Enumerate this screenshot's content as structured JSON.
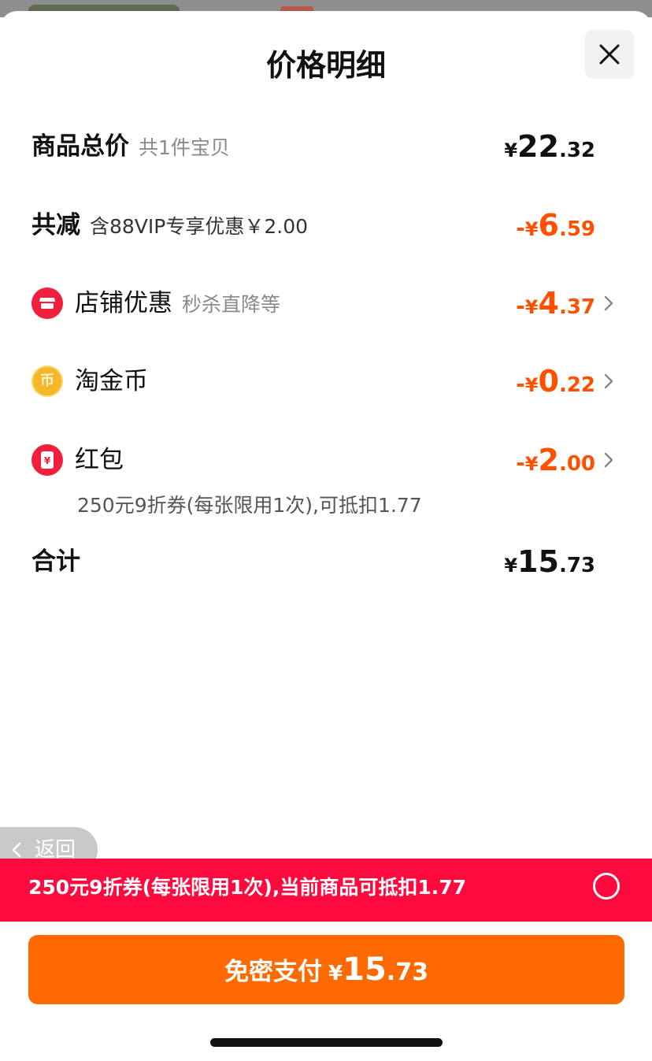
{
  "sheet": {
    "title": "价格明细"
  },
  "rows": {
    "total": {
      "label": "商品总价",
      "sub": "共1件宝贝",
      "sym": "¥",
      "int": "22",
      "dec": ".32"
    },
    "reduced": {
      "label": "共减",
      "sub": "含88VIP专享优惠￥2.00",
      "minus": "-",
      "sym": "¥",
      "int": "6",
      "dec": ".59"
    },
    "shop": {
      "icon": "shop-icon",
      "label": "店铺优惠",
      "sub": "秒杀直降等",
      "minus": "-",
      "sym": "¥",
      "int": "4",
      "dec": ".37"
    },
    "coins": {
      "icon": "coin-icon",
      "icon_glyph": "币",
      "label": "淘金币",
      "minus": "-",
      "sym": "¥",
      "int": "0",
      "dec": ".22"
    },
    "redpacket": {
      "icon": "red-packet-icon",
      "icon_glyph": "¥",
      "label": "红包",
      "minus": "-",
      "sym": "¥",
      "int": "2",
      "dec": ".00",
      "note": "250元9折券(每张限用1次),可抵扣1.77"
    },
    "sum": {
      "label": "合计",
      "sym": "¥",
      "int": "15",
      "dec": ".73"
    }
  },
  "back": {
    "label": "返回"
  },
  "coupon_bar": {
    "text": "250元9折券(每张限用1次),当前商品可抵扣1.77"
  },
  "pay": {
    "label": "免密支付",
    "sym": "¥",
    "int": "15",
    "dec": ".73"
  },
  "colors": {
    "accent_orange": "#ff5000",
    "coupon_red": "#ff0a3f",
    "pay_orange": "#ff6a00"
  }
}
